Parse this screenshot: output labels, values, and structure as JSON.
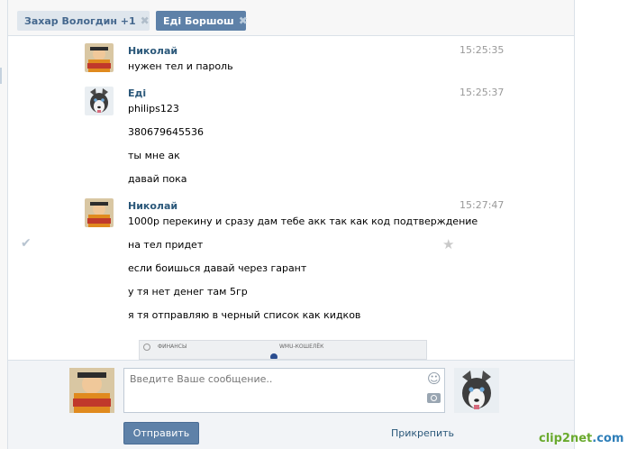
{
  "tabs": [
    {
      "label": "Захар Вологдин +1",
      "close": "✖"
    },
    {
      "label": "Еді Боршош",
      "close": "✖"
    }
  ],
  "messages": [
    {
      "author": "Николай",
      "time": "15:25:35",
      "avatar": "naruto-avatar",
      "lines": [
        "нужен тел и пароль"
      ]
    },
    {
      "author": "Еді",
      "time": "15:25:37",
      "avatar": "husky-avatar",
      "lines": [
        "philips123",
        "380679645536",
        "ты мне ак",
        "давай пока"
      ]
    },
    {
      "author": "Николай",
      "time": "15:27:47",
      "avatar": "naruto-avatar",
      "lines": [
        "1000р перекину и сразу дам тебе акк так как код подтверждение",
        "на тел придет",
        "если боишься давай через гарант",
        "у тя нет денег там 5гр",
        "я тя отправляю в черный список как кидков"
      ]
    }
  ],
  "preview": {
    "left_title": "ФИНАНСЫ",
    "right_title": "WMU-КОШЕЛЁК"
  },
  "composer": {
    "placeholder": "Введите Ваше сообщение..",
    "send_label": "Отправить",
    "attach_label": "Прикрепить"
  },
  "icons": {
    "check": "✔",
    "star": "★",
    "smile": "☺"
  },
  "watermark": {
    "text": "clip2net",
    "suffix": ".com"
  },
  "colors": {
    "accent": "#5e81a8",
    "link": "#2b587a",
    "muted": "#999999"
  }
}
